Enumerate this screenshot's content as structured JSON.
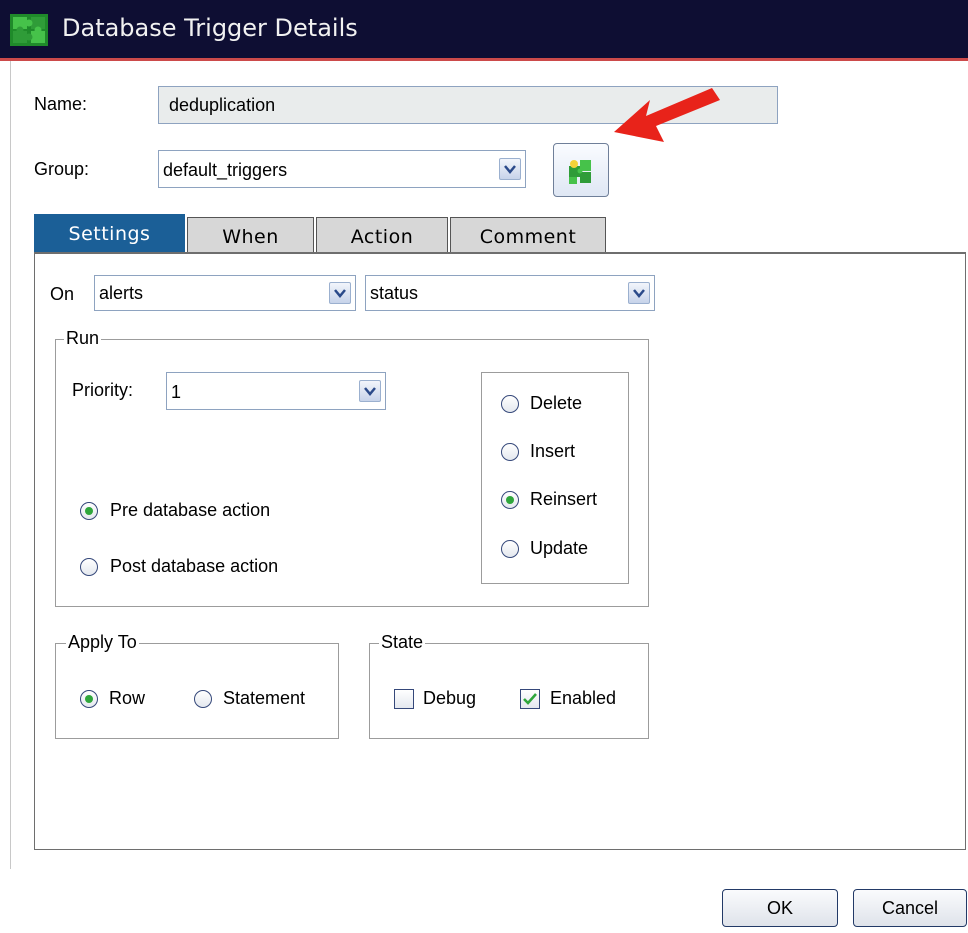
{
  "window": {
    "title": "Database Trigger Details"
  },
  "form": {
    "name_label": "Name:",
    "name_value": "deduplication",
    "group_label": "Group:",
    "group_value": "default_triggers"
  },
  "tabs": [
    {
      "label": "Settings",
      "active": true
    },
    {
      "label": "When",
      "active": false
    },
    {
      "label": "Action",
      "active": false
    },
    {
      "label": "Comment",
      "active": false
    }
  ],
  "settings": {
    "on_label": "On",
    "on_table": "alerts",
    "on_column": "status",
    "run": {
      "legend": "Run",
      "priority_label": "Priority:",
      "priority_value": "1",
      "timing": [
        {
          "label": "Pre database action",
          "selected": true
        },
        {
          "label": "Post database action",
          "selected": false
        }
      ],
      "events": [
        {
          "label": "Delete",
          "selected": false
        },
        {
          "label": "Insert",
          "selected": false
        },
        {
          "label": "Reinsert",
          "selected": true
        },
        {
          "label": "Update",
          "selected": false
        }
      ]
    },
    "apply_to": {
      "legend": "Apply To",
      "options": [
        {
          "label": "Row",
          "selected": true
        },
        {
          "label": "Statement",
          "selected": false
        }
      ]
    },
    "state": {
      "legend": "State",
      "options": [
        {
          "label": "Debug",
          "checked": false
        },
        {
          "label": "Enabled",
          "checked": true
        }
      ]
    }
  },
  "footer": {
    "ok": "OK",
    "cancel": "Cancel"
  },
  "colors": {
    "title_bg": "#0e0e33",
    "tab_active": "#1b5f97",
    "radio_dot": "#2fa63c",
    "arrow": "#e8231a"
  },
  "icons": [
    "puzzle-icon",
    "puzzle-group-icon",
    "chevron-down-icon",
    "red-arrow-icon",
    "checkmark-icon"
  ]
}
